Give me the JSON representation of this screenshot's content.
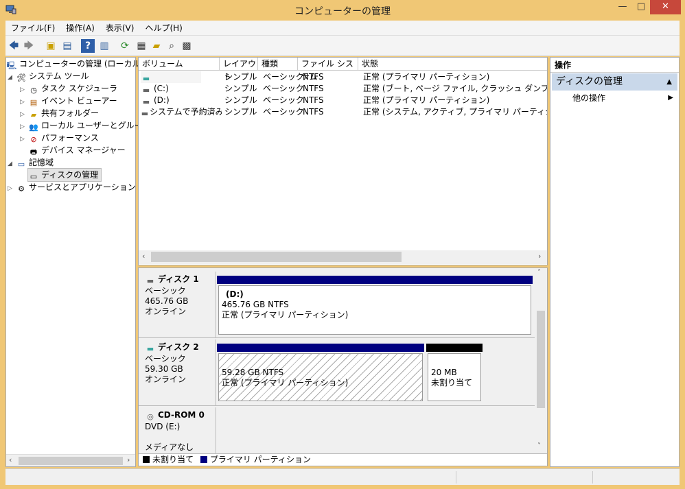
{
  "window": {
    "title": "コンピューターの管理",
    "min": "—",
    "max": "□",
    "close": "✕"
  },
  "menu": [
    "ファイル(F)",
    "操作(A)",
    "表示(V)",
    "ヘルプ(H)"
  ],
  "tree": {
    "root": "コンピューターの管理 (ローカル)",
    "system_tools": "システム ツール",
    "task_scheduler": "タスク スケジューラ",
    "event_viewer": "イベント ビューアー",
    "shared_folders": "共有フォルダー",
    "local_users": "ローカル ユーザーとグループ",
    "performance": "パフォーマンス",
    "device_manager": "デバイス マネージャー",
    "storage": "記憶域",
    "disk_management": "ディスクの管理",
    "services_apps": "サービスとアプリケーション"
  },
  "volumes": {
    "headers": [
      "ボリューム",
      "レイアウト",
      "種類",
      "ファイル システム",
      "状態"
    ],
    "rows": [
      {
        "volume": "",
        "layout": "シンプル",
        "type": "ベーシック",
        "fs": "NTFS",
        "status": "正常 (プライマリ パーティション)"
      },
      {
        "volume": "(C:)",
        "layout": "シンプル",
        "type": "ベーシック",
        "fs": "NTFS",
        "status": "正常 (ブート, ページ ファイル, クラッシュ ダンプ, プライマリ"
      },
      {
        "volume": "(D:)",
        "layout": "シンプル",
        "type": "ベーシック",
        "fs": "NTFS",
        "status": "正常 (プライマリ パーティション)"
      },
      {
        "volume": "システムで予約済み",
        "layout": "シンプル",
        "type": "ベーシック",
        "fs": "NTFS",
        "status": "正常 (システム, アクティブ, プライマリ パーティション)"
      }
    ]
  },
  "disks": {
    "disk1": {
      "name": "ディスク 1",
      "kind": "ベーシック",
      "size": "465.76 GB",
      "state": "オンライン",
      "part_name": "(D:)",
      "part_size": "465.76 GB NTFS",
      "part_status": "正常 (プライマリ パーティション)"
    },
    "disk2": {
      "name": "ディスク 2",
      "kind": "ベーシック",
      "size": "59.30 GB",
      "state": "オンライン",
      "part_size": "59.28 GB NTFS",
      "part_status": "正常 (プライマリ パーティション)",
      "unalloc_size": "20 MB",
      "unalloc_label": "未割り当て"
    },
    "cdrom": {
      "name": "CD-ROM 0",
      "drive": "DVD (E:)",
      "media": "メディアなし"
    }
  },
  "legend": {
    "unallocated": "未割り当て",
    "primary": "プライマリ パーティション"
  },
  "actions": {
    "header": "操作",
    "section": "ディスクの管理",
    "more": "他の操作"
  },
  "colors": {
    "title_bar": "#f0c775",
    "primary_partition": "#000080",
    "unallocated": "#000000",
    "action_highlight": "#c9d8ea"
  }
}
